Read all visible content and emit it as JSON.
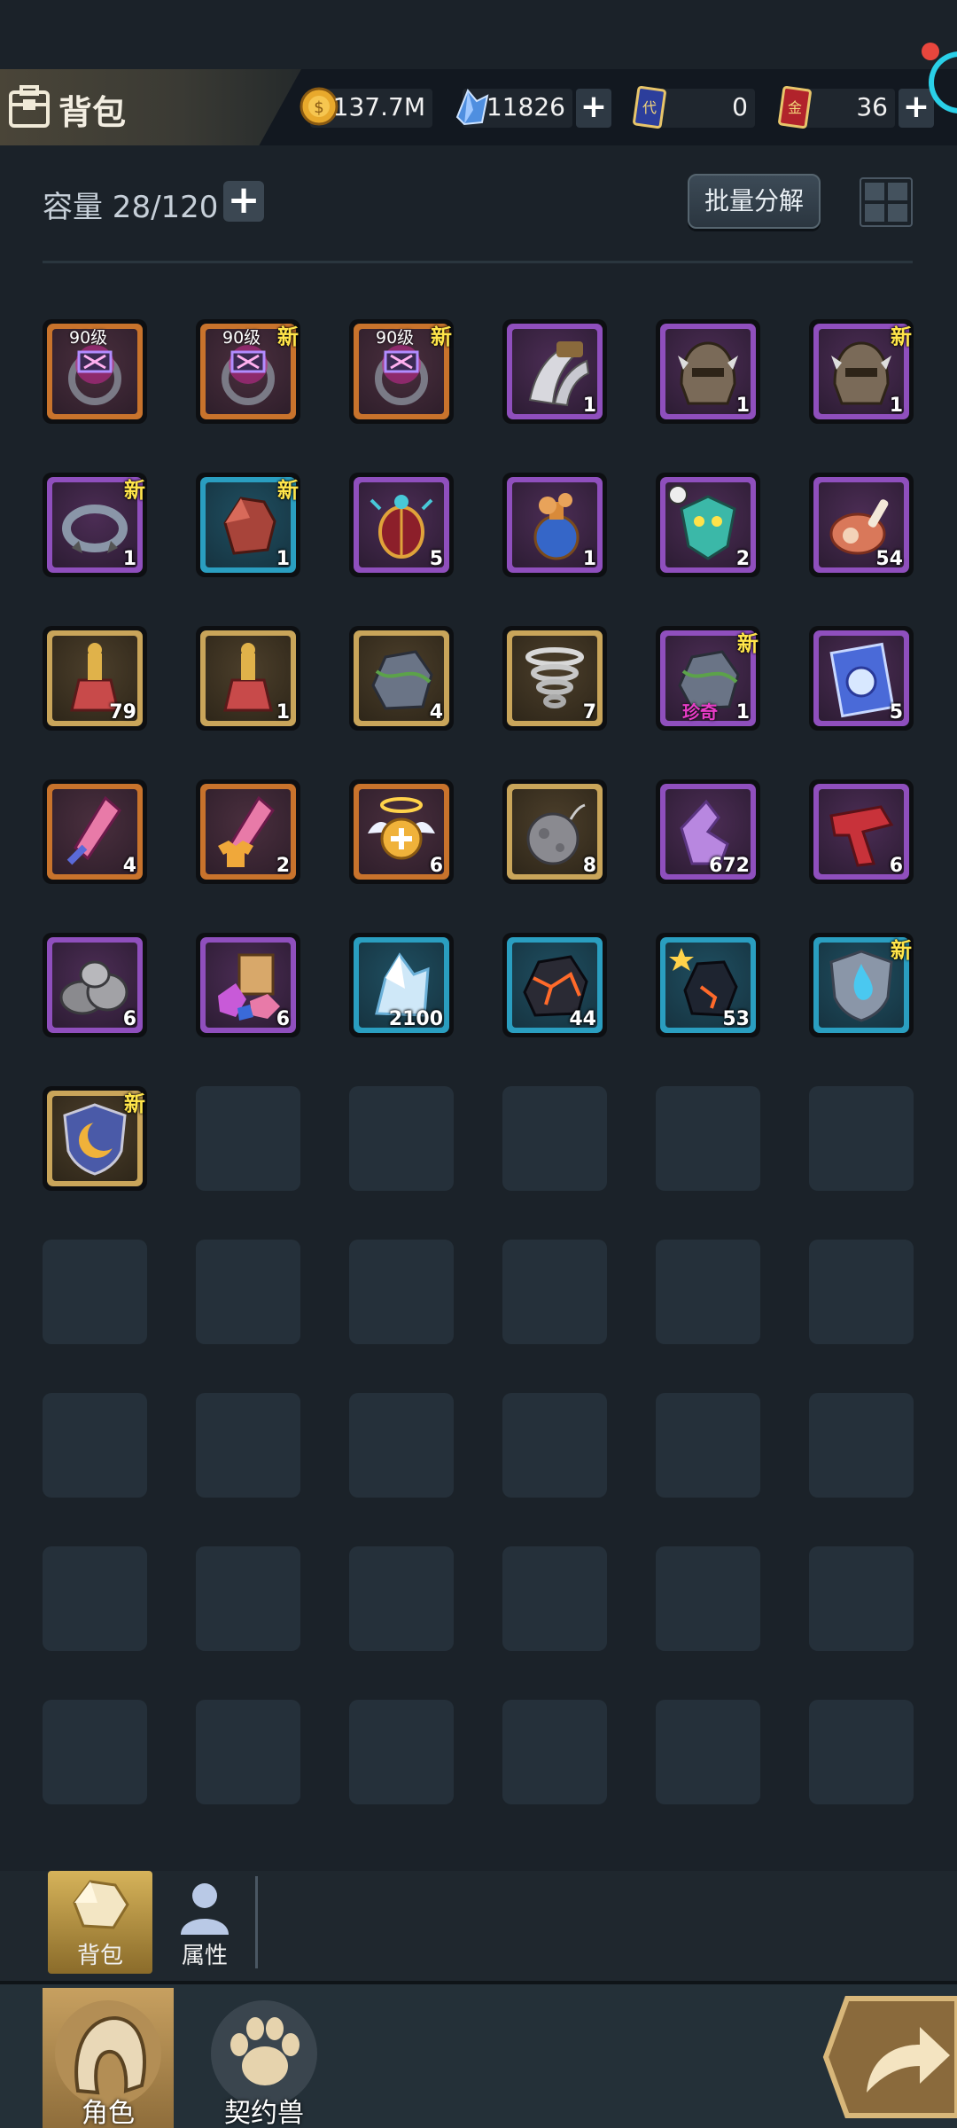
{
  "header": {
    "title": "背包",
    "gold": "137.7M",
    "crystals": "11826",
    "ticket_blue": "0",
    "ticket_red": "36"
  },
  "capacity": {
    "label": "容量 28/120"
  },
  "actions": {
    "batch_decompose": "批量分解"
  },
  "items": [
    {
      "rarity": "orange",
      "icon": "dark-ring",
      "level": "90级"
    },
    {
      "rarity": "orange",
      "icon": "dark-ring",
      "level": "90级",
      "new": "新"
    },
    {
      "rarity": "orange",
      "icon": "dark-ring",
      "level": "90级",
      "new": "新"
    },
    {
      "rarity": "purple",
      "icon": "claw",
      "count": "1"
    },
    {
      "rarity": "purple",
      "icon": "helmet",
      "count": "1"
    },
    {
      "rarity": "purple",
      "icon": "helmet",
      "count": "1",
      "new": "新"
    },
    {
      "rarity": "purple",
      "icon": "collar",
      "count": "1",
      "new": "新"
    },
    {
      "rarity": "blue",
      "icon": "red-rock",
      "count": "1",
      "new": "新"
    },
    {
      "rarity": "purple",
      "icon": "scarab",
      "count": "5"
    },
    {
      "rarity": "purple",
      "icon": "potion",
      "count": "1"
    },
    {
      "rarity": "purple",
      "icon": "dragon-mask",
      "count": "2"
    },
    {
      "rarity": "purple",
      "icon": "meat",
      "count": "54"
    },
    {
      "rarity": "gold",
      "icon": "elixir",
      "count": "79"
    },
    {
      "rarity": "gold",
      "icon": "elixir",
      "count": "1"
    },
    {
      "rarity": "gold",
      "icon": "vine-rock",
      "count": "4"
    },
    {
      "rarity": "gold",
      "icon": "whirlwind",
      "count": "7"
    },
    {
      "rarity": "purple",
      "icon": "vine-rock",
      "count": "1",
      "new": "新",
      "tag": "珍奇"
    },
    {
      "rarity": "purple",
      "icon": "scroll",
      "count": "5"
    },
    {
      "rarity": "orange",
      "icon": "crystal-sword",
      "count": "4"
    },
    {
      "rarity": "orange",
      "icon": "crystal-shirt",
      "count": "2"
    },
    {
      "rarity": "orange",
      "icon": "angel-heal",
      "count": "6"
    },
    {
      "rarity": "gold",
      "icon": "moon-bomb",
      "count": "8"
    },
    {
      "rarity": "purple",
      "icon": "purple-crystal",
      "count": "672"
    },
    {
      "rarity": "purple",
      "icon": "red-scarf",
      "count": "6"
    },
    {
      "rarity": "purple",
      "icon": "stone-pile",
      "count": "6"
    },
    {
      "rarity": "purple",
      "icon": "gem-pile",
      "count": "6"
    },
    {
      "rarity": "blue",
      "icon": "ice-crystal",
      "count": "2100"
    },
    {
      "rarity": "blue",
      "icon": "lava-ore",
      "count": "44"
    },
    {
      "rarity": "blue",
      "icon": "star-ore",
      "count": "53"
    },
    {
      "rarity": "blue",
      "icon": "blue-shield",
      "new": "新"
    },
    {
      "rarity": "gold",
      "icon": "moon-shield",
      "new": "新"
    }
  ],
  "empty_slots": 29,
  "subtabs": [
    {
      "label": "背包",
      "active": true
    },
    {
      "label": "属性",
      "active": false
    }
  ],
  "nav": [
    {
      "label": "角色",
      "active": true
    },
    {
      "label": "契约兽",
      "active": false
    }
  ],
  "colors": {
    "background": "#1b2229",
    "new_badge": "#ffe54a",
    "tab_active": "#c7a060"
  }
}
